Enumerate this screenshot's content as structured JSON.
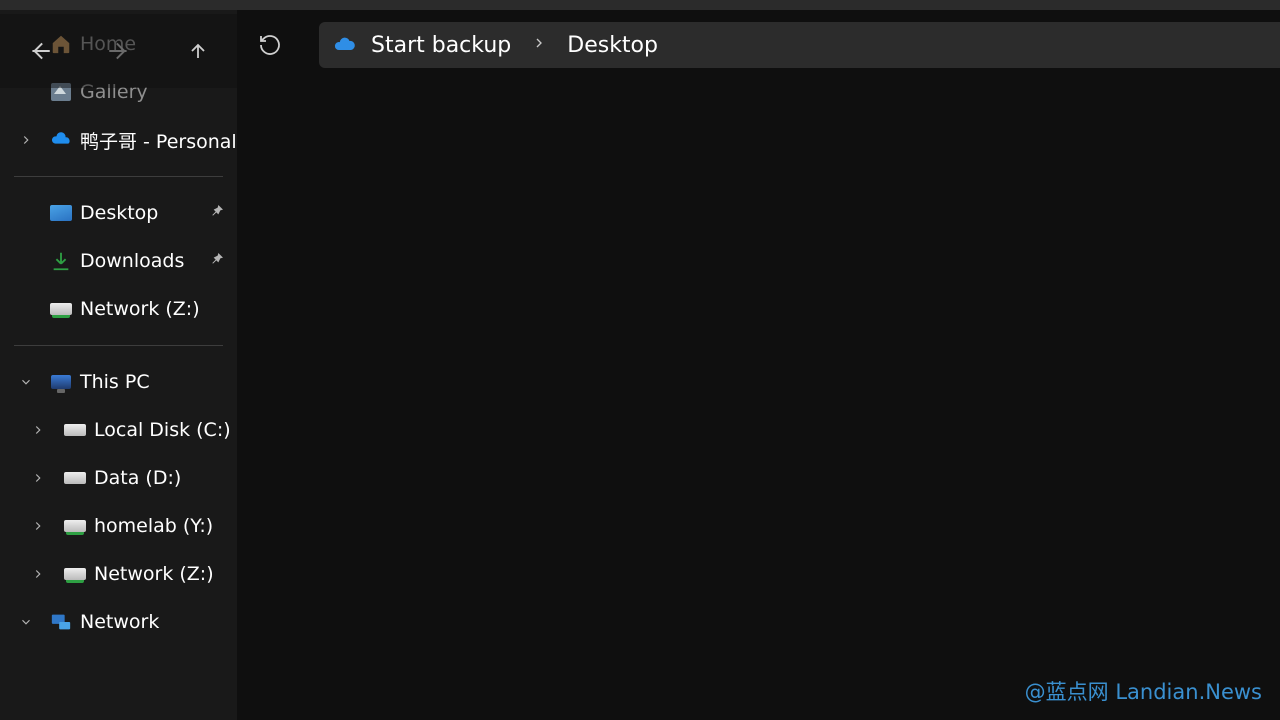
{
  "sidebar": {
    "home": "Home",
    "gallery": "Gallery",
    "personal": "鸭子哥 - Personal",
    "quick": {
      "desktop": "Desktop",
      "downloads": "Downloads",
      "networkZ": "Network (Z:)"
    },
    "thisPC": {
      "label": "This PC",
      "drives": {
        "localC": "Local Disk (C:)",
        "dataD": "Data (D:)",
        "homelabY": "homelab (Y:)",
        "networkZ": "Network (Z:)"
      }
    },
    "network": "Network"
  },
  "breadcrumb": {
    "startBackup": "Start backup",
    "current": "Desktop"
  },
  "watermark": {
    "part1": "@蓝点网 ",
    "part2": "Landian.News"
  }
}
